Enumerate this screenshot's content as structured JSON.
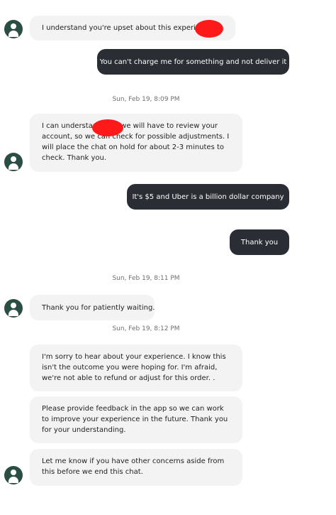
{
  "conversation": {
    "messages": [
      {
        "sender": "agent",
        "text": "I understand you're upset about this experience."
      },
      {
        "sender": "user",
        "text": "You can't charge me for something and not deliver it"
      },
      {
        "sender": "agent",
        "text": "I can understand that we will have to review your account, so we can check for possible adjustments. I will place the chat on hold for about 2-3 minutes to check. Thank you."
      },
      {
        "sender": "user",
        "text": "It's $5 and Uber is a billion dollar company"
      },
      {
        "sender": "user",
        "text": "Thank you"
      },
      {
        "sender": "agent",
        "text": "Thank you for patiently waiting."
      },
      {
        "sender": "agent",
        "text": "I'm sorry to hear about your experience. I know this isn't the outcome you were hoping for. I'm afraid, we're not able to refund or adjust for this order.  ."
      },
      {
        "sender": "agent",
        "text": "Please provide feedback in the app so we can work to improve your experience in the future. Thank you for your understanding."
      },
      {
        "sender": "agent",
        "text": "Let me know if you have other concerns aside from this before we end this chat."
      }
    ],
    "timestamps": [
      "Sun, Feb 19, 8:09 PM",
      "Sun, Feb 19, 8:11 PM",
      "Sun, Feb 19, 8:12 PM"
    ]
  },
  "colors": {
    "agent_bubble": "#f3f3f3",
    "user_bubble": "#2a2d33",
    "avatar": "#2b4e44",
    "redaction": "#ff1a1a",
    "timestamp_text": "#6f6f6f"
  },
  "icons": {
    "avatar": "support-agent-avatar-icon"
  }
}
